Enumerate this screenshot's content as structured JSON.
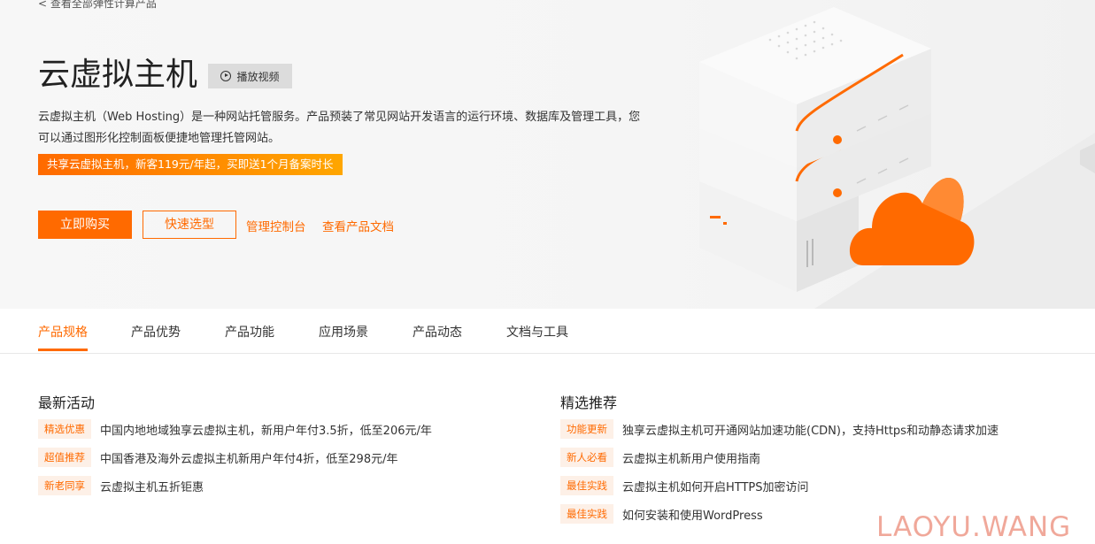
{
  "hero": {
    "back_link": "< 查看全部弹性计算产品",
    "title": "云虚拟主机",
    "video_button": "播放视频",
    "description": "云虚拟主机（Web Hosting）是一种网站托管服务。产品预装了常见网站开发语言的运行环境、数据库及管理工具，您可以通过图形化控制面板便捷地管理托管网站。",
    "promo": "共享云虚拟主机，新客119元/年起，买即送1个月备案时长",
    "buy_button": "立即购买",
    "select_button": "快速选型",
    "console_link": "管理控制台",
    "docs_link": "查看产品文档"
  },
  "tabs": [
    "产品规格",
    "产品优势",
    "产品功能",
    "应用场景",
    "产品动态",
    "文档与工具"
  ],
  "latest": {
    "title": "最新活动",
    "items": [
      {
        "tag": "精选优惠",
        "text": "中国内地地域独享云虚拟主机，新用户年付3.5折，低至206元/年"
      },
      {
        "tag": "超值推荐",
        "text": "中国香港及海外云虚拟主机新用户年付4折，低至298元/年"
      },
      {
        "tag": "新老同享",
        "text": "云虚拟主机五折钜惠"
      }
    ]
  },
  "recommend": {
    "title": "精选推荐",
    "items": [
      {
        "tag": "功能更新",
        "text": "独享云虚拟主机可开通网站加速功能(CDN)，支持Https和动静态请求加速"
      },
      {
        "tag": "新人必看",
        "text": "云虚拟主机新用户使用指南"
      },
      {
        "tag": "最佳实践",
        "text": "云虚拟主机如何开启HTTPS加密访问"
      },
      {
        "tag": "最佳实践",
        "text": "如何安装和使用WordPress"
      }
    ]
  },
  "watermark": "LAOYU.WANG",
  "colors": {
    "accent": "#ff6a00",
    "tag_bg": "#fdf0e7",
    "promo_end": "#ffa600"
  }
}
